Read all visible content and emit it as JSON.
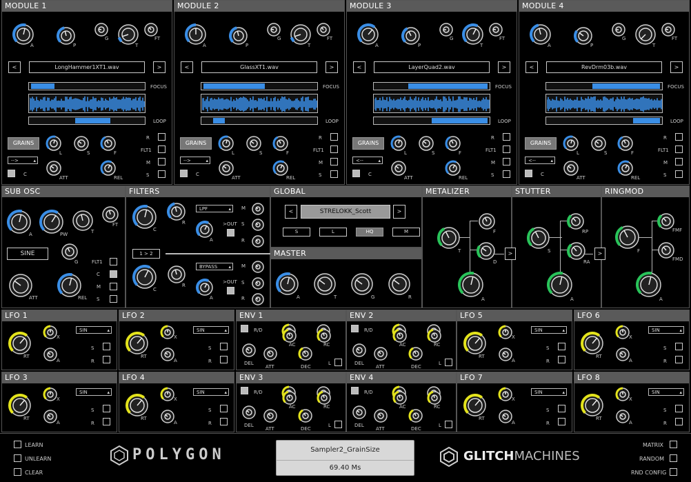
{
  "modules": [
    {
      "title": "MODULE 1",
      "file": "LongHammer1XT1.wav",
      "focus": [
        0.02,
        0.22
      ],
      "loop": [
        0.4,
        0.7
      ],
      "dir": "-->"
    },
    {
      "title": "MODULE 2",
      "file": "GlassXT1.wav",
      "focus": [
        0.02,
        0.55
      ],
      "loop": [
        0.1,
        0.2
      ],
      "dir": "-->"
    },
    {
      "title": "MODULE 3",
      "file": "LayerQuad2.wav",
      "focus": [
        0.3,
        0.98
      ],
      "loop": [
        0.5,
        0.98
      ],
      "dir": "<--"
    },
    {
      "title": "MODULE 4",
      "file": "RevDrm03b.wav",
      "focus": [
        0.4,
        0.98
      ],
      "loop": [
        0.75,
        0.98
      ],
      "dir": "<--"
    }
  ],
  "module_labels": {
    "a": "A",
    "p": "P",
    "g": "G",
    "t": "T",
    "ft": "FT",
    "focus": "FOCUS",
    "loop": "LOOP",
    "grains": "GRAINS",
    "l": "L",
    "s": "S",
    "f": "F",
    "att": "ATT",
    "rel": "REL",
    "c": "C",
    "r": "R",
    "flt1": "FLT1",
    "m": "M",
    "ss": "S",
    "prev": "<",
    "next": ">"
  },
  "subosc": {
    "title": "SUB OSC",
    "wave": "SINE",
    "a": "A",
    "pw": "PW",
    "t": "T",
    "ft": "FT",
    "g": "G",
    "att": "ATT",
    "rel": "REL",
    "flt1": "FLT1",
    "c": "C",
    "m": "M",
    "s": "S"
  },
  "filters": {
    "title": "FILTERS",
    "type1": "LPF",
    "type2": "BYPASS",
    "route": "1 > 2",
    "c": "C",
    "r": "R",
    "a": "A",
    "out": ">OUT",
    "m": "M",
    "s": "S",
    "rr": "R"
  },
  "global": {
    "title": "GLOBAL",
    "preset": "STRELOKK_Scott",
    "prev": "<",
    "next": ">",
    "buttons": [
      "S",
      "L",
      "HQ",
      "M"
    ]
  },
  "master": {
    "title": "MASTER",
    "knobs": [
      "A",
      "T",
      "G",
      "R"
    ]
  },
  "metalizer": {
    "title": "METALIZER",
    "t": "T",
    "f": "F",
    "d": "D",
    "a": "A",
    "arrow": ">"
  },
  "stutter": {
    "title": "STUTTER",
    "s": "S",
    "rp": "RP",
    "ra": "RA",
    "a": "A",
    "arrow": ">"
  },
  "ringmod": {
    "title": "RINGMOD",
    "f": "F",
    "fmf": "FMF",
    "fmd": "FMD",
    "a": "A"
  },
  "lfos": [
    {
      "title": "LFO 1",
      "wave": "SIN"
    },
    {
      "title": "LFO 2",
      "wave": "SIN"
    },
    {
      "title": "LFO 5",
      "wave": "SIN"
    },
    {
      "title": "LFO 6",
      "wave": "SIN"
    },
    {
      "title": "LFO 3",
      "wave": "SIN"
    },
    {
      "title": "LFO 4",
      "wave": "SIN"
    },
    {
      "title": "LFO 7",
      "wave": "SIN"
    },
    {
      "title": "LFO 8",
      "wave": "SIN"
    }
  ],
  "lfo_labels": {
    "rt": "RT",
    "x": "X",
    "a": "A",
    "s": "S",
    "r": "R"
  },
  "envs": [
    {
      "title": "ENV 1"
    },
    {
      "title": "ENV 2"
    },
    {
      "title": "ENV 3"
    },
    {
      "title": "ENV 4"
    }
  ],
  "env_labels": {
    "rd": "R/D",
    "ac": "AC",
    "rc": "RC",
    "del": "DEL",
    "att": "ATT",
    "dec": "DEC",
    "l": "L"
  },
  "footer": {
    "learn": "LEARN",
    "unlearn": "UNLEARN",
    "clear": "CLEAR",
    "param": "Sampler2_GrainSize",
    "value": "69.40 Ms",
    "matrix": "MATRIX",
    "random": "RANDOM",
    "rnd": "RND CONFIG",
    "logo": "POLYGON",
    "brand1": "GLITCH",
    "brand2": "MACHINES"
  },
  "colors": {
    "accent": "#3a8ee6",
    "green": "#29c35a",
    "yellow": "#e3e31c"
  }
}
